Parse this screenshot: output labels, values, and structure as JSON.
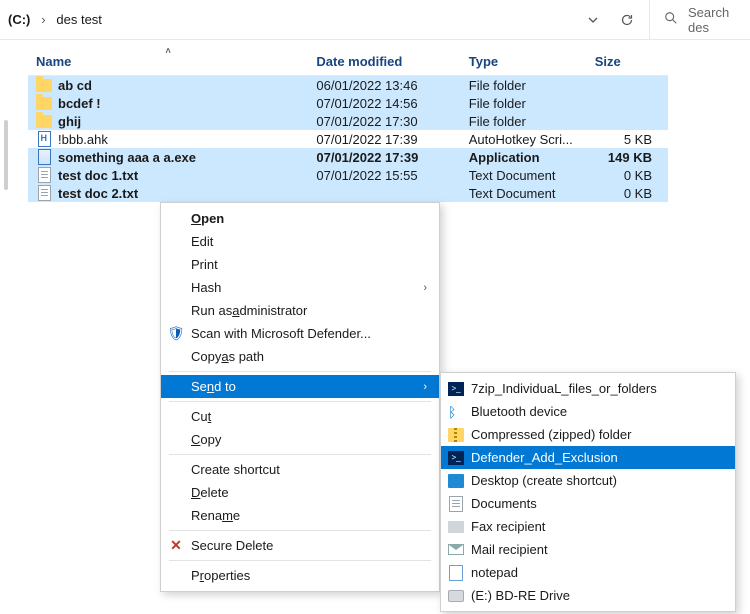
{
  "addr": {
    "drive": "(C:)",
    "folder": "des test"
  },
  "search": {
    "placeholder": "Search des"
  },
  "columns": {
    "name": "Name",
    "date": "Date modified",
    "type": "Type",
    "size": "Size"
  },
  "rows": [
    {
      "name": "ab cd",
      "date": "06/01/2022 13:46",
      "type": "File folder",
      "size": "",
      "icon": "folder",
      "cls": "sel"
    },
    {
      "name": "bcdef !",
      "date": "07/01/2022 14:56",
      "type": "File folder",
      "size": "",
      "icon": "folder",
      "cls": "sel"
    },
    {
      "name": "ghij",
      "date": "07/01/2022 17:30",
      "type": "File folder",
      "size": "",
      "icon": "folder",
      "cls": "sel"
    },
    {
      "name": "!bbb.ahk",
      "date": "07/01/2022 17:39",
      "type": "AutoHotkey Scri...",
      "size": "5 KB",
      "icon": "h",
      "cls": "plain"
    },
    {
      "name": "something  aaa     a     a.exe",
      "date": "07/01/2022 17:39",
      "type": "Application",
      "size": "149 KB",
      "icon": "exe",
      "cls": "selstrong"
    },
    {
      "name": "test doc 1.txt",
      "date": "07/01/2022 15:55",
      "type": "Text Document",
      "size": "0 KB",
      "icon": "txt",
      "cls": "sel"
    },
    {
      "name": "test doc 2.txt",
      "date": "",
      "type": "Text Document",
      "size": "0 KB",
      "icon": "txt",
      "cls": "sel"
    }
  ],
  "ctx": {
    "open": "Open",
    "edit": "Edit",
    "print": "Print",
    "hash": "Hash",
    "runas": "Run as administrator",
    "scan": "Scan with Microsoft Defender...",
    "copypath": "Copy as path",
    "sendto": "Send to",
    "cut": "Cut",
    "copy": "Copy",
    "shortcut": "Create shortcut",
    "delete": "Delete",
    "rename": "Rename",
    "secdel": "Secure Delete",
    "props": "Properties"
  },
  "sendto": [
    {
      "label": "7zip_IndividuaL_files_or_folders",
      "icon": "ps",
      "hi": false
    },
    {
      "label": "Bluetooth device",
      "icon": "bt",
      "hi": false
    },
    {
      "label": "Compressed (zipped) folder",
      "icon": "zip",
      "hi": false
    },
    {
      "label": "Defender_Add_Exclusion",
      "icon": "ps",
      "hi": true
    },
    {
      "label": "Desktop (create shortcut)",
      "icon": "desk",
      "hi": false
    },
    {
      "label": "Documents",
      "icon": "doc",
      "hi": false
    },
    {
      "label": "Fax recipient",
      "icon": "fax",
      "hi": false
    },
    {
      "label": "Mail recipient",
      "icon": "mail",
      "hi": false
    },
    {
      "label": "notepad",
      "icon": "np",
      "hi": false
    },
    {
      "label": "(E:) BD-RE Drive",
      "icon": "drv",
      "hi": false
    }
  ]
}
